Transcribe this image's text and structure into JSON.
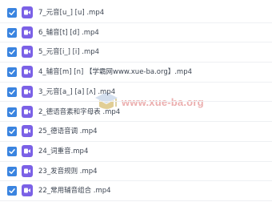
{
  "files": [
    {
      "name": "7_元音[u_] [u] .mp4",
      "checked": true,
      "icon": "video-file-icon"
    },
    {
      "name": "6_辅音[t] [d] .mp4",
      "checked": true,
      "icon": "video-file-icon"
    },
    {
      "name": "5_元音[i_] [i] .mp4",
      "checked": true,
      "icon": "video-file-icon"
    },
    {
      "name": "4_辅音[m] [n] 【学霸网www.xue-ba.org】.mp4",
      "checked": true,
      "icon": "video-file-icon"
    },
    {
      "name": "3_元音[a_] [a] [ʌ] .mp4",
      "checked": true,
      "icon": "video-file-icon"
    },
    {
      "name": "2_德语音素和字母表 .mp4",
      "checked": true,
      "icon": "video-file-icon"
    },
    {
      "name": "25_德语音调 .mp4",
      "checked": true,
      "icon": "video-file-icon"
    },
    {
      "name": "24_词重音.mp4",
      "checked": true,
      "icon": "video-file-icon"
    },
    {
      "name": "23_发音规则 .mp4",
      "checked": true,
      "icon": "video-file-icon"
    },
    {
      "name": "22_常用辅音组合 .mp4",
      "checked": true,
      "icon": "video-file-icon"
    }
  ],
  "watermark": {
    "text": "www.xue-ba.org"
  },
  "colors": {
    "checkbox": "#3a84e0",
    "video_icon": "#7b61e6",
    "text": "#3d4552",
    "divider": "#eef0f3",
    "watermark": "#e8a0a0"
  }
}
